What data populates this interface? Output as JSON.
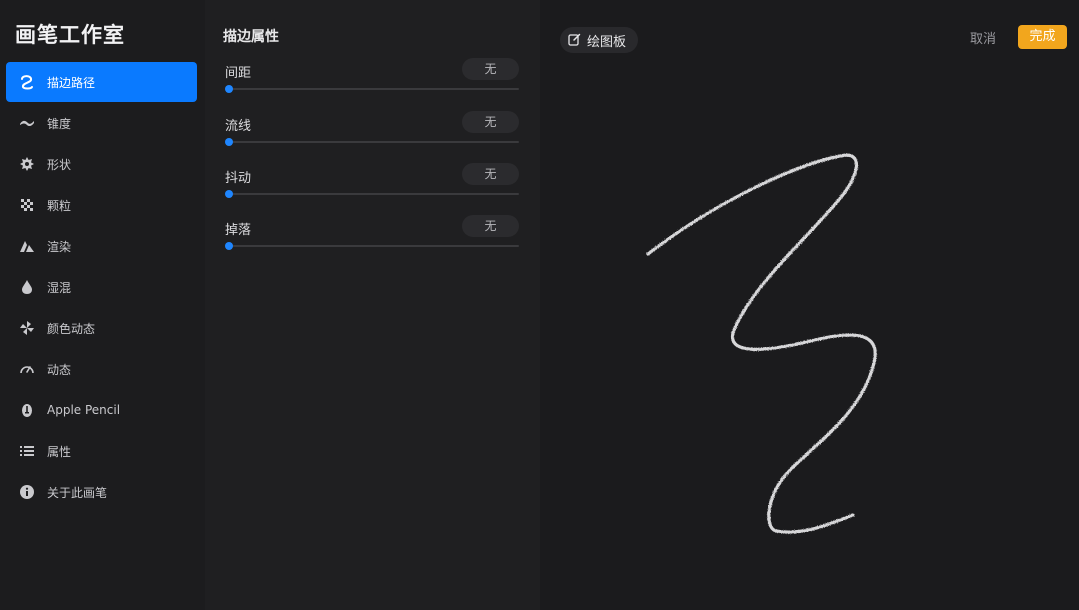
{
  "app_title": "画笔工作室",
  "sidebar": {
    "items": [
      {
        "label": "描边路径",
        "icon": "stroke-path-icon",
        "active": true
      },
      {
        "label": "锥度",
        "icon": "taper-icon",
        "active": false
      },
      {
        "label": "形状",
        "icon": "shape-icon",
        "active": false
      },
      {
        "label": "颗粒",
        "icon": "grain-icon",
        "active": false
      },
      {
        "label": "渲染",
        "icon": "rendering-icon",
        "active": false
      },
      {
        "label": "湿混",
        "icon": "wet-mix-icon",
        "active": false
      },
      {
        "label": "颜色动态",
        "icon": "color-dynamics-icon",
        "active": false
      },
      {
        "label": "动态",
        "icon": "dynamics-icon",
        "active": false
      },
      {
        "label": "Apple Pencil",
        "icon": "apple-pencil-icon",
        "active": false
      },
      {
        "label": "属性",
        "icon": "properties-icon",
        "active": false
      },
      {
        "label": "关于此画笔",
        "icon": "about-icon",
        "active": false
      }
    ]
  },
  "panel": {
    "title": "描边属性",
    "settings": [
      {
        "label": "间距",
        "value": "无",
        "level": 0
      },
      {
        "label": "流线",
        "value": "无",
        "level": 0
      },
      {
        "label": "抖动",
        "value": "无",
        "level": 0
      },
      {
        "label": "掉落",
        "value": "无",
        "level": 0
      }
    ]
  },
  "drawpad": {
    "button_label": "绘图板",
    "cancel_label": "取消",
    "done_label": "完成"
  },
  "colors": {
    "accent": "#0a7aff",
    "done": "#f2a61d",
    "slider": "#1f86ff"
  }
}
